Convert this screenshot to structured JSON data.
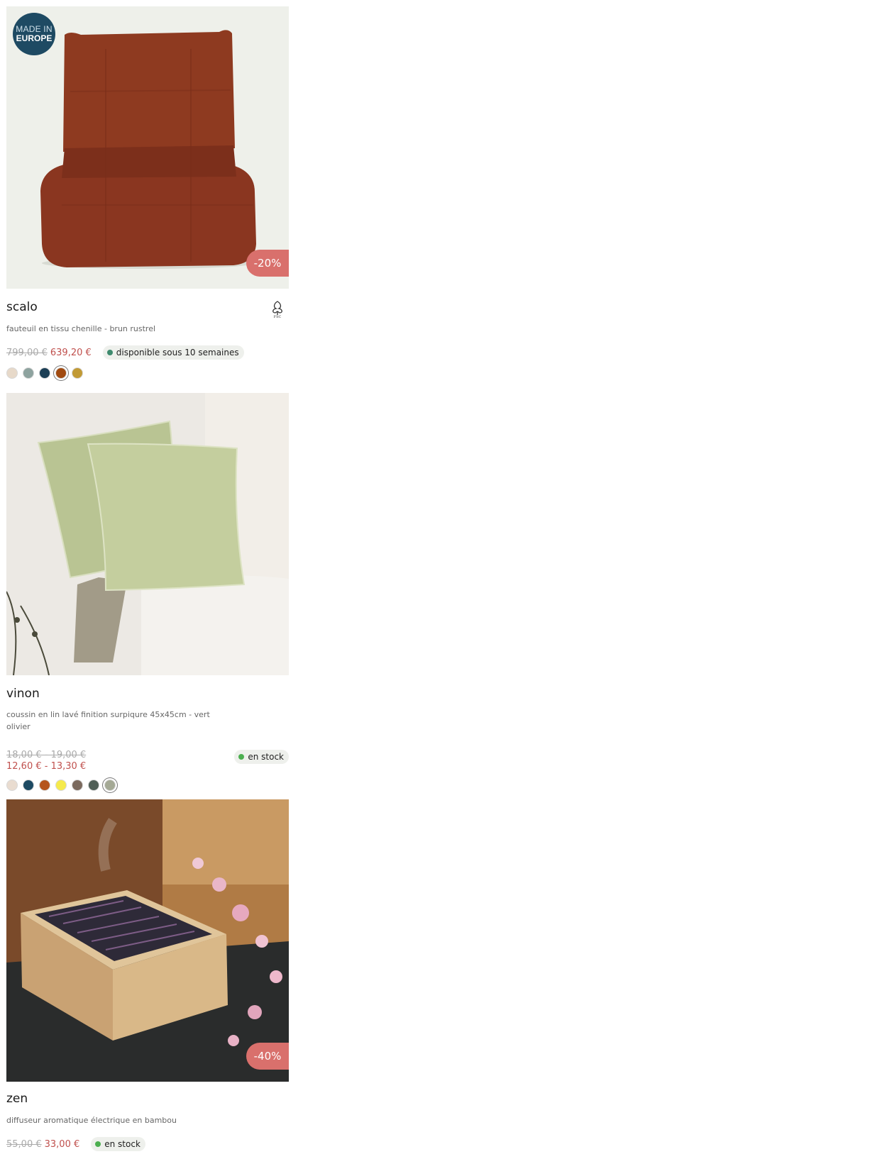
{
  "products": [
    {
      "name": "scalo",
      "description": "fauteuil en tissu chenille - brun rustrel",
      "badge_line1": "MADE IN",
      "badge_line2": "EUROPE",
      "discount": "-20%",
      "old_price": "799,00 €",
      "new_price": "639,20 €",
      "availability": "disponible sous 10 semaines",
      "availability_color": "#3e8a6e",
      "certification_icon": "fsc-tree-icon",
      "swatches": [
        "#e7d9c9",
        "#8ea39f",
        "#1c3f56",
        "#a14a10",
        "#c19a35"
      ],
      "selected_swatch": 3
    },
    {
      "name": "vinon",
      "description": "coussin en lin lavé finition surpiqure 45x45cm - vert olivier",
      "old_price": "18,00 € - 19,00 €",
      "new_price": "12,60 € - 13,30 €",
      "availability": "en stock",
      "availability_color": "#4caf50",
      "swatches": [
        "#e9dcd0",
        "#1d4a63",
        "#b5541c",
        "#f5ea4c",
        "#7b6a5e",
        "#4f5e56",
        "#a4a995"
      ],
      "selected_swatch": 6
    },
    {
      "name": "zen",
      "description": "diffuseur aromatique électrique en bambou",
      "discount": "-40%",
      "old_price": "55,00 €",
      "new_price": "33,00 €",
      "availability": "en stock",
      "availability_color": "#4caf50"
    }
  ]
}
